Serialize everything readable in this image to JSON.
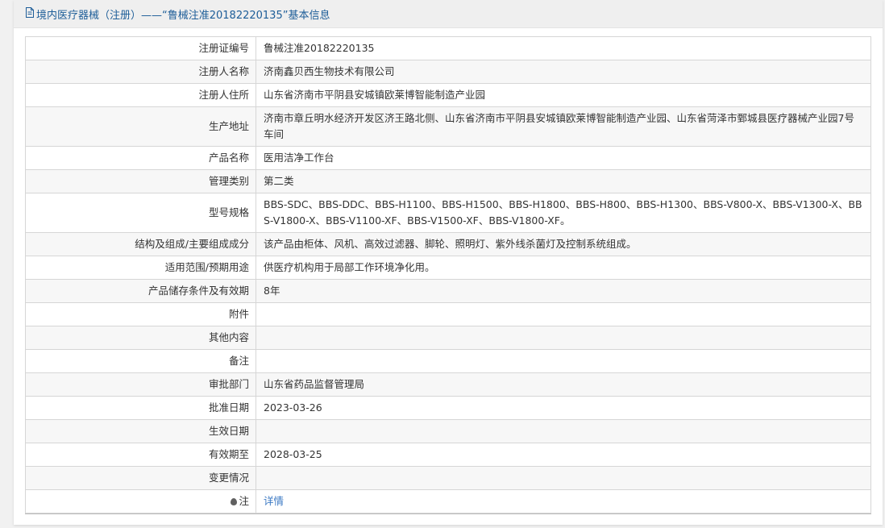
{
  "header": {
    "title": "境内医疗器械（注册）——“鲁械注准20182220135”基本信息",
    "icon": "document-icon"
  },
  "colors": {
    "header_text": "#1d5d98",
    "link": "#3a78c3"
  },
  "rows": [
    {
      "label": "注册证编号",
      "value": "鲁械注准20182220135"
    },
    {
      "label": "注册人名称",
      "value": "济南鑫贝西生物技术有限公司"
    },
    {
      "label": "注册人住所",
      "value": "山东省济南市平阴县安城镇欧莱博智能制造产业园"
    },
    {
      "label": "生产地址",
      "value": "济南市章丘明水经济开发区济王路北侧、山东省济南市平阴县安城镇欧莱博智能制造产业园、山东省菏泽市鄄城县医疗器械产业园7号车间"
    },
    {
      "label": "产品名称",
      "value": "医用洁净工作台"
    },
    {
      "label": "管理类别",
      "value": "第二类"
    },
    {
      "label": "型号规格",
      "value": "BBS-SDC、BBS-DDC、BBS-H1100、BBS-H1500、BBS-H1800、BBS-H800、BBS-H1300、BBS-V800-X、BBS-V1300-X、BBS-V1800-X、BBS-V1100-XF、BBS-V1500-XF、BBS-V1800-XF。"
    },
    {
      "label": "结构及组成/主要组成成分",
      "value": "该产品由柜体、风机、高效过滤器、脚轮、照明灯、紫外线杀菌灯及控制系统组成。"
    },
    {
      "label": "适用范围/预期用途",
      "value": "供医疗机构用于局部工作环境净化用。"
    },
    {
      "label": "产品储存条件及有效期",
      "value": "8年"
    },
    {
      "label": "附件",
      "value": ""
    },
    {
      "label": "其他内容",
      "value": ""
    },
    {
      "label": "备注",
      "value": ""
    },
    {
      "label": "审批部门",
      "value": "山东省药品监督管理局"
    },
    {
      "label": "批准日期",
      "value": "2023-03-26"
    },
    {
      "label": "生效日期",
      "value": ""
    },
    {
      "label": "有效期至",
      "value": "2028-03-25"
    },
    {
      "label": "变更情况",
      "value": ""
    }
  ],
  "note_row": {
    "icon": "note-icon",
    "label": "注",
    "link_text": "详情"
  }
}
